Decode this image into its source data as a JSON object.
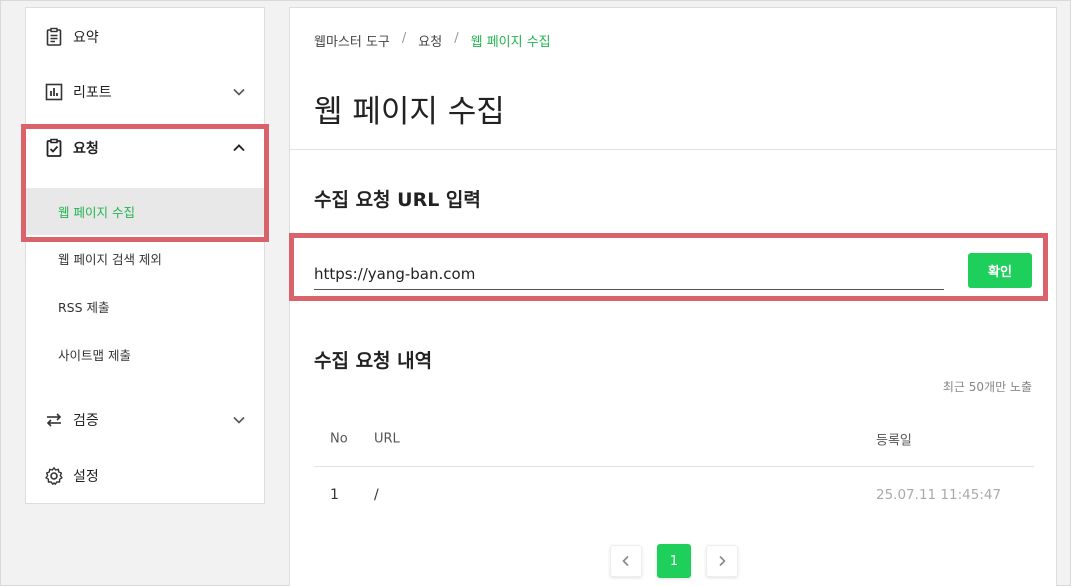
{
  "sidebar": {
    "items": [
      {
        "label": "요약",
        "icon": "clipboard-icon"
      },
      {
        "label": "리포트",
        "icon": "bar-chart-icon"
      },
      {
        "label": "요청",
        "icon": "checklist-icon"
      },
      {
        "label": "검증",
        "icon": "swap-icon"
      },
      {
        "label": "설정",
        "icon": "gear-icon"
      }
    ],
    "sub_items": [
      {
        "label": "웹 페이지 수집"
      },
      {
        "label": "웹 페이지 검색 제외"
      },
      {
        "label": "RSS 제출"
      },
      {
        "label": "사이트맵 제출"
      }
    ]
  },
  "breadcrumb": [
    "웹마스터 도구",
    "요청",
    "웹 페이지 수집"
  ],
  "page_title": "웹 페이지 수집",
  "form": {
    "title": "수집 요청 URL 입력",
    "url_value": "https://yang-ban.com",
    "confirm_label": "확인"
  },
  "history": {
    "title": "수집 요청 내역",
    "note": "최근 50개만 노출",
    "columns": [
      "No",
      "URL",
      "등록일"
    ],
    "rows": [
      {
        "no": "1",
        "url": "/",
        "date": "25.07.11 11:45:47"
      }
    ]
  },
  "pagination": {
    "current": "1"
  },
  "colors": {
    "accent": "#1fcf5c",
    "highlight": "#d9626b"
  }
}
